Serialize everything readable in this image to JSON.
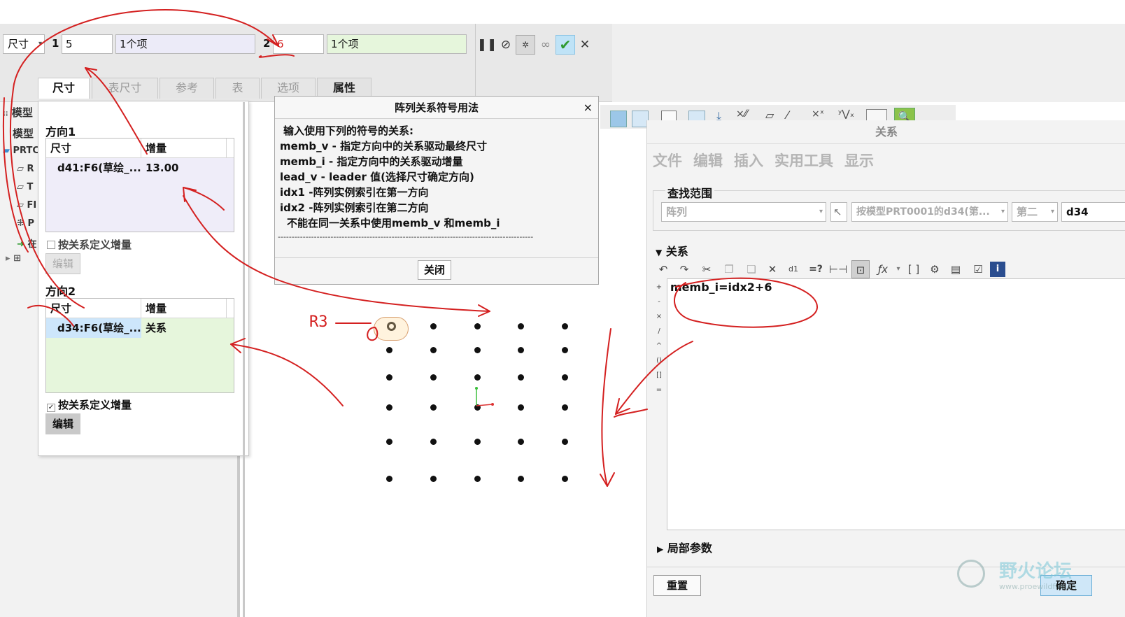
{
  "dashboard": {
    "type_select": "尺寸",
    "dir1_label": "1",
    "dir1_value": "5",
    "dir1_items": "1个项",
    "dir2_label": "2",
    "dir2_value": "6",
    "dir2_items": "1个项",
    "tabs": [
      "尺寸",
      "表尺寸",
      "参考",
      "表",
      "选项",
      "属性"
    ]
  },
  "tree": {
    "header": "模型",
    "header2": "模型",
    "items": [
      "PRTC",
      "R",
      "T",
      "FI",
      "P",
      "在"
    ]
  },
  "dim_panel": {
    "direction1": {
      "title": "方向1",
      "col_dim": "尺寸",
      "col_inc": "增量",
      "dim": "d41:F6(草绘_...",
      "inc": "13.00",
      "relation_checkbox": "按关系定义增量",
      "edit_button": "编辑"
    },
    "direction2": {
      "title": "方向2",
      "col_dim": "尺寸",
      "col_inc": "增量",
      "dim": "d34:F6(草绘_...",
      "inc": "关系",
      "relation_checkbox": "按关系定义增量",
      "edit_button": "编辑"
    }
  },
  "help_dialog": {
    "title": "阵列关系符号用法",
    "close_icon": "×",
    "lines": [
      "输入使用下列的符号的关系:",
      "memb_v - 指定方向中的关系驱动最终尺寸",
      "memb_i - 指定方向中的关系驱动增量",
      "lead_v - leader 值(选择尺寸确定方向)",
      "idx1    -阵列实例索引在第一方向",
      "idx2    -阵列实例索引在第二方向",
      "不能在同一关系中使用memb_v 和memb_i"
    ],
    "separator": "--------------------------------------------------------------------------------------------",
    "close_button": "关闭"
  },
  "relations": {
    "title": "关系",
    "menu": [
      "文件",
      "编辑",
      "插入",
      "实用工具",
      "显示"
    ],
    "lookin_label": "查找范围",
    "lookin_type": "阵列",
    "lookin_model": "按模型PRT0001的d34(第...",
    "lookin_dir": "第二",
    "lookin_dim": "d34",
    "relations_section": "关系",
    "relation_text": "memb_i=idx2+6",
    "local_params": "局部参数",
    "reset_button": "重置",
    "ok_button": "确定",
    "side_ops": [
      "+",
      "-",
      "×",
      "/",
      "^",
      "()",
      "[]",
      "="
    ]
  },
  "annotations": {
    "r3_label": "R3"
  },
  "watermark": {
    "text": "野火论坛",
    "url": "www.proewildfire.cn"
  },
  "colors": {
    "annotation_red": "#d42020",
    "check_green": "#2f9a2f",
    "selection_blue": "#cde6fb",
    "pale_green": "#e6f6dc",
    "lavender": "#efedf9"
  }
}
